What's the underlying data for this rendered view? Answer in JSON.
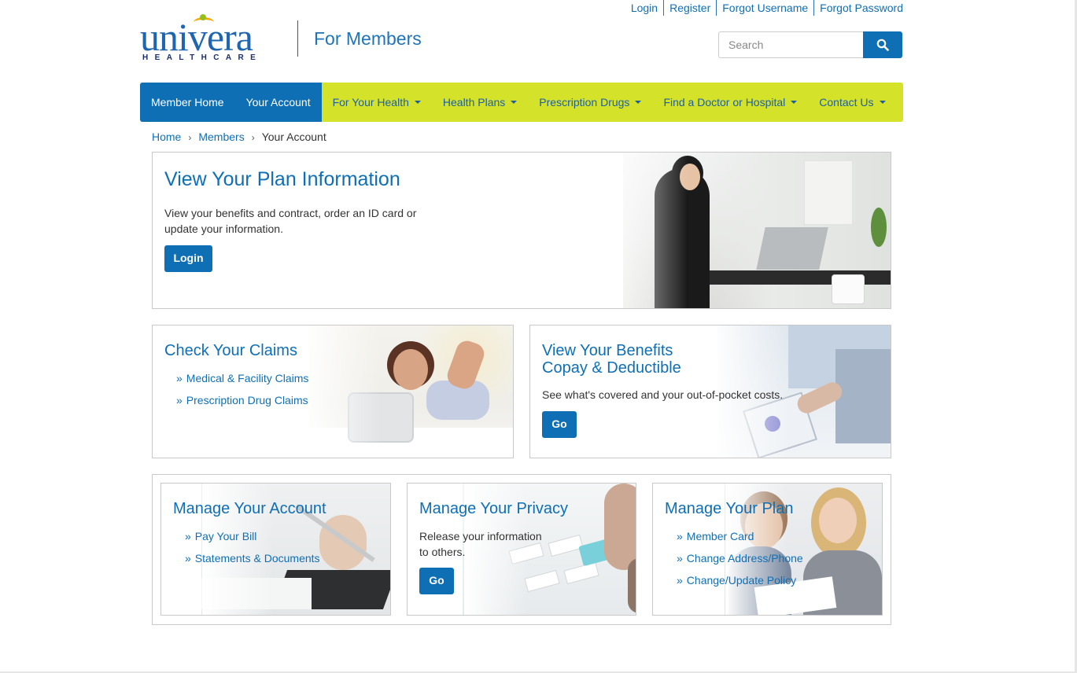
{
  "header": {
    "logo_word": "univera",
    "logo_sub": "HEALTHCARE",
    "tagline": "For Members",
    "util_links": [
      "Login",
      "Register",
      "Forgot Username",
      "Forgot Password"
    ],
    "search_placeholder": "Search"
  },
  "nav": {
    "primary": [
      "Member Home",
      "Your Account"
    ],
    "items": [
      "For Your Health",
      "Health Plans",
      "Prescription Drugs",
      "Find a Doctor or Hospital",
      "Contact Us"
    ]
  },
  "breadcrumb": [
    "Home",
    "Members",
    "Your Account"
  ],
  "plan_card": {
    "title": "View Your Plan Information",
    "text": "View your benefits and contract, order an ID card or update your information.",
    "button": "Login"
  },
  "claims_card": {
    "title": "Check Your Claims",
    "links": [
      "Medical & Facility Claims",
      "Prescription Drug Claims"
    ]
  },
  "benefits_card": {
    "title_line1": "View Your Benefits",
    "title_line2": "Copay & Deductible",
    "text": "See what's covered and your out-of-pocket costs.",
    "button": "Go"
  },
  "account_card": {
    "title": "Manage Your Account",
    "links": [
      "Pay Your Bill",
      "Statements & Documents"
    ]
  },
  "privacy_card": {
    "title": "Manage Your Privacy",
    "text": "Release your information to others.",
    "button": "Go"
  },
  "plan_manage_card": {
    "title": "Manage Your Plan",
    "links": [
      "Member Card",
      "Change Address/Phone",
      "Change/Update Policy"
    ]
  },
  "colors": {
    "brand_blue": "#0f6fb5",
    "nav_green": "#d5e22a"
  }
}
